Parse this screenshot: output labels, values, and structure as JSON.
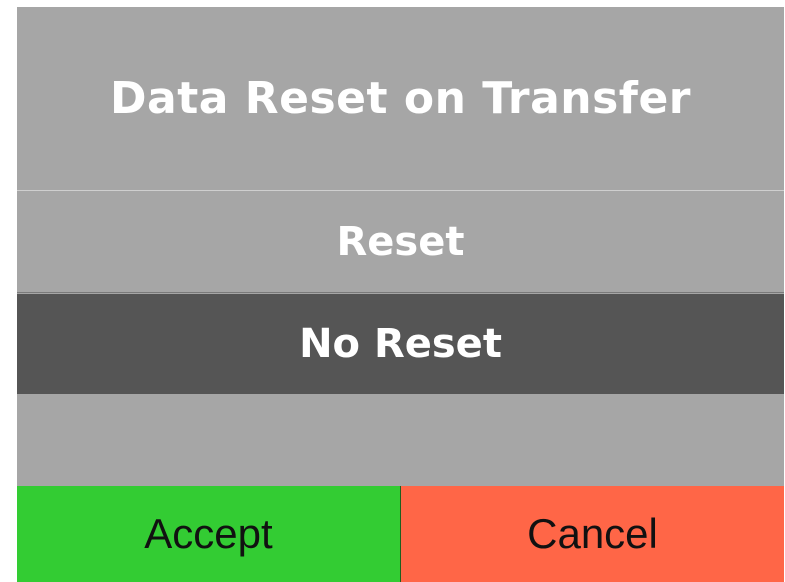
{
  "dialog": {
    "title": "Data Reset on Transfer",
    "options": [
      {
        "label": "Reset",
        "selected": false
      },
      {
        "label": "No Reset",
        "selected": true
      }
    ],
    "buttons": {
      "accept_label": "Accept",
      "cancel_label": "Cancel"
    }
  },
  "colors": {
    "dialog_background": "#a6a6a6",
    "selected_option": "#555555",
    "accept": "#33cc33",
    "cancel": "#ff6647",
    "title_text": "#ffffff"
  }
}
